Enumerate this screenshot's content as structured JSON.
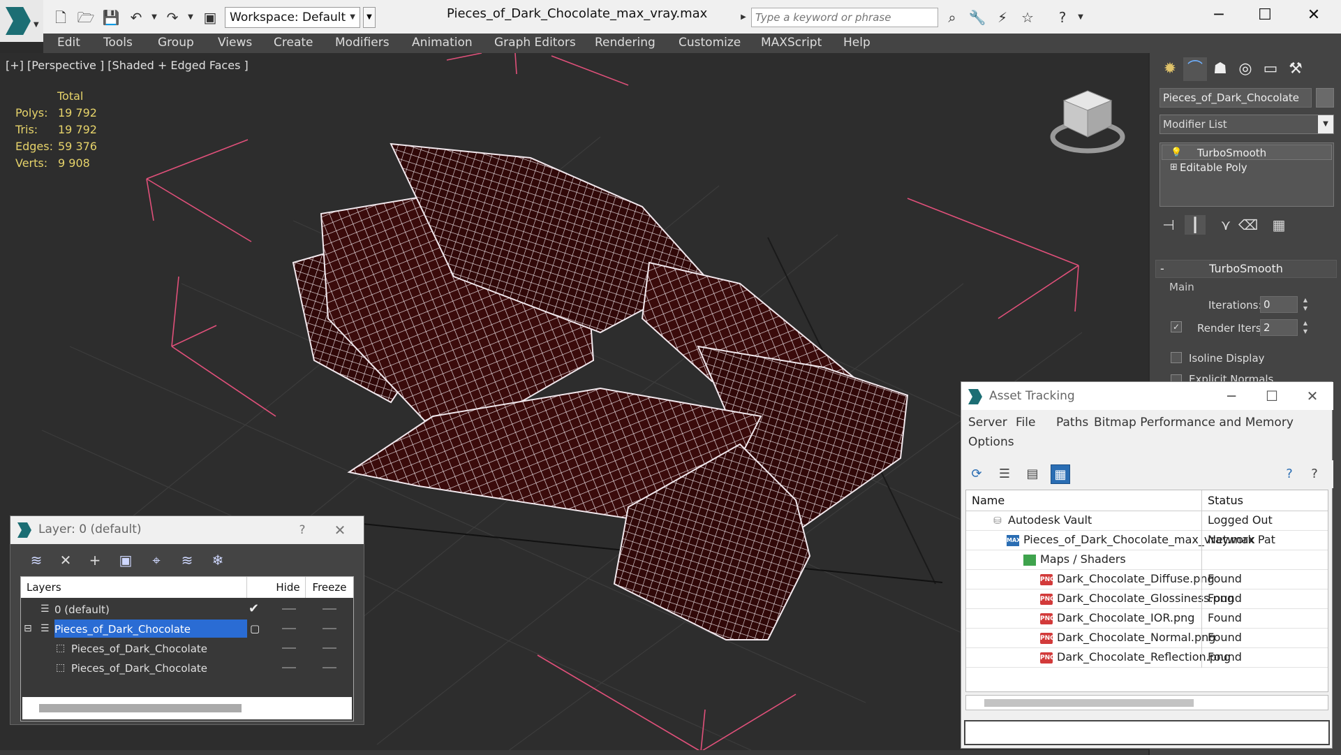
{
  "titlebar": {
    "workspace_label": "Workspace: Default",
    "file_title": "Pieces_of_Dark_Chocolate_max_vray.max",
    "search_placeholder": "Type a keyword or phrase",
    "minimize": "─",
    "maximize": "☐",
    "close": "✕"
  },
  "menu": [
    "Edit",
    "Tools",
    "Group",
    "Views",
    "Create",
    "Modifiers",
    "Animation",
    "Graph Editors",
    "Rendering",
    "Customize",
    "MAXScript",
    "Help"
  ],
  "viewport": {
    "label": "[+] [Perspective ] [Shaded + Edged Faces ]",
    "stats_header": "Total",
    "stats": [
      {
        "key": "Polys:",
        "value": "19 792"
      },
      {
        "key": "Tris:",
        "value": "19 792"
      },
      {
        "key": "Edges:",
        "value": "59 376"
      },
      {
        "key": "Verts:",
        "value": "9 908"
      }
    ]
  },
  "command_panel": {
    "object_name": "Pieces_of_Dark_Chocolate",
    "modifier_list": "Modifier List",
    "stack": [
      "TurboSmooth",
      "Editable Poly"
    ],
    "rollout_title": "TurboSmooth",
    "rollout_minus": "-",
    "main_label": "Main",
    "iterations_label": "Iterations:",
    "iterations_value": "0",
    "render_iters_label": "Render Iters:",
    "render_iters_value": "2",
    "isoline_label": "Isoline Display",
    "explicit_label": "Explicit Normals"
  },
  "asset_tracking": {
    "title": "Asset Tracking",
    "menu": [
      "Server",
      "File",
      "Paths",
      "Bitmap Performance and Memory",
      "Options"
    ],
    "columns": [
      "Name",
      "Status"
    ],
    "rows": [
      {
        "name": "Autodesk Vault",
        "status": "Logged Out",
        "indent": 0,
        "icon": "vault-icon"
      },
      {
        "name": "Pieces_of_Dark_Chocolate_max_vray.max",
        "status": "Network Pat",
        "indent": 1,
        "icon": "max-file-icon"
      },
      {
        "name": "Maps / Shaders",
        "status": "",
        "indent": 2,
        "icon": "maps-icon"
      },
      {
        "name": "Dark_Chocolate_Diffuse.png",
        "status": "Found",
        "indent": 3,
        "icon": "png-icon"
      },
      {
        "name": "Dark_Chocolate_Glossiness.png",
        "status": "Found",
        "indent": 3,
        "icon": "png-icon"
      },
      {
        "name": "Dark_Chocolate_IOR.png",
        "status": "Found",
        "indent": 3,
        "icon": "png-icon"
      },
      {
        "name": "Dark_Chocolate_Normal.png",
        "status": "Found",
        "indent": 3,
        "icon": "png-icon"
      },
      {
        "name": "Dark_Chocolate_Reflection.png",
        "status": "Found",
        "indent": 3,
        "icon": "png-icon"
      }
    ],
    "png_badge": "PNG"
  },
  "layer_window": {
    "title": "Layer: 0 (default)",
    "help": "?",
    "close": "✕",
    "columns": [
      "Layers",
      "Hide",
      "Freeze"
    ],
    "rows": [
      {
        "name": "0 (default)",
        "indent": 1,
        "selected": false,
        "current": true
      },
      {
        "name": "Pieces_of_Dark_Chocolate",
        "indent": 1,
        "selected": true,
        "current": false
      },
      {
        "name": "Pieces_of_Dark_Chocolate",
        "indent": 2,
        "selected": false,
        "current": false
      },
      {
        "name": "Pieces_of_Dark_Chocolate",
        "indent": 2,
        "selected": false,
        "current": false
      }
    ]
  },
  "colors": {
    "wire": "#f2e9ee",
    "chocolate": "#3a0b0b",
    "stats": "#e6d36a",
    "selection": "#2a6cd4",
    "gizmo": "#e0507a"
  }
}
